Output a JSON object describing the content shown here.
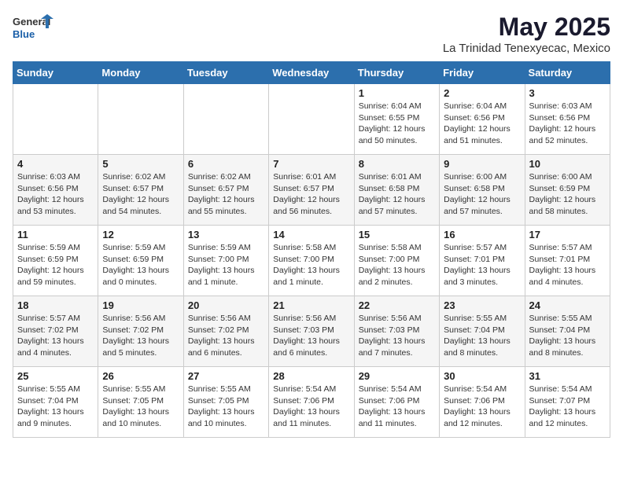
{
  "header": {
    "logo_general": "General",
    "logo_blue": "Blue",
    "month_year": "May 2025",
    "location": "La Trinidad Tenexyecac, Mexico"
  },
  "weekdays": [
    "Sunday",
    "Monday",
    "Tuesday",
    "Wednesday",
    "Thursday",
    "Friday",
    "Saturday"
  ],
  "weeks": [
    [
      {
        "day": "",
        "info": ""
      },
      {
        "day": "",
        "info": ""
      },
      {
        "day": "",
        "info": ""
      },
      {
        "day": "",
        "info": ""
      },
      {
        "day": "1",
        "info": "Sunrise: 6:04 AM\nSunset: 6:55 PM\nDaylight: 12 hours\nand 50 minutes."
      },
      {
        "day": "2",
        "info": "Sunrise: 6:04 AM\nSunset: 6:56 PM\nDaylight: 12 hours\nand 51 minutes."
      },
      {
        "day": "3",
        "info": "Sunrise: 6:03 AM\nSunset: 6:56 PM\nDaylight: 12 hours\nand 52 minutes."
      }
    ],
    [
      {
        "day": "4",
        "info": "Sunrise: 6:03 AM\nSunset: 6:56 PM\nDaylight: 12 hours\nand 53 minutes."
      },
      {
        "day": "5",
        "info": "Sunrise: 6:02 AM\nSunset: 6:57 PM\nDaylight: 12 hours\nand 54 minutes."
      },
      {
        "day": "6",
        "info": "Sunrise: 6:02 AM\nSunset: 6:57 PM\nDaylight: 12 hours\nand 55 minutes."
      },
      {
        "day": "7",
        "info": "Sunrise: 6:01 AM\nSunset: 6:57 PM\nDaylight: 12 hours\nand 56 minutes."
      },
      {
        "day": "8",
        "info": "Sunrise: 6:01 AM\nSunset: 6:58 PM\nDaylight: 12 hours\nand 57 minutes."
      },
      {
        "day": "9",
        "info": "Sunrise: 6:00 AM\nSunset: 6:58 PM\nDaylight: 12 hours\nand 57 minutes."
      },
      {
        "day": "10",
        "info": "Sunrise: 6:00 AM\nSunset: 6:59 PM\nDaylight: 12 hours\nand 58 minutes."
      }
    ],
    [
      {
        "day": "11",
        "info": "Sunrise: 5:59 AM\nSunset: 6:59 PM\nDaylight: 12 hours\nand 59 minutes."
      },
      {
        "day": "12",
        "info": "Sunrise: 5:59 AM\nSunset: 6:59 PM\nDaylight: 13 hours\nand 0 minutes."
      },
      {
        "day": "13",
        "info": "Sunrise: 5:59 AM\nSunset: 7:00 PM\nDaylight: 13 hours\nand 1 minute."
      },
      {
        "day": "14",
        "info": "Sunrise: 5:58 AM\nSunset: 7:00 PM\nDaylight: 13 hours\nand 1 minute."
      },
      {
        "day": "15",
        "info": "Sunrise: 5:58 AM\nSunset: 7:00 PM\nDaylight: 13 hours\nand 2 minutes."
      },
      {
        "day": "16",
        "info": "Sunrise: 5:57 AM\nSunset: 7:01 PM\nDaylight: 13 hours\nand 3 minutes."
      },
      {
        "day": "17",
        "info": "Sunrise: 5:57 AM\nSunset: 7:01 PM\nDaylight: 13 hours\nand 4 minutes."
      }
    ],
    [
      {
        "day": "18",
        "info": "Sunrise: 5:57 AM\nSunset: 7:02 PM\nDaylight: 13 hours\nand 4 minutes."
      },
      {
        "day": "19",
        "info": "Sunrise: 5:56 AM\nSunset: 7:02 PM\nDaylight: 13 hours\nand 5 minutes."
      },
      {
        "day": "20",
        "info": "Sunrise: 5:56 AM\nSunset: 7:02 PM\nDaylight: 13 hours\nand 6 minutes."
      },
      {
        "day": "21",
        "info": "Sunrise: 5:56 AM\nSunset: 7:03 PM\nDaylight: 13 hours\nand 6 minutes."
      },
      {
        "day": "22",
        "info": "Sunrise: 5:56 AM\nSunset: 7:03 PM\nDaylight: 13 hours\nand 7 minutes."
      },
      {
        "day": "23",
        "info": "Sunrise: 5:55 AM\nSunset: 7:04 PM\nDaylight: 13 hours\nand 8 minutes."
      },
      {
        "day": "24",
        "info": "Sunrise: 5:55 AM\nSunset: 7:04 PM\nDaylight: 13 hours\nand 8 minutes."
      }
    ],
    [
      {
        "day": "25",
        "info": "Sunrise: 5:55 AM\nSunset: 7:04 PM\nDaylight: 13 hours\nand 9 minutes."
      },
      {
        "day": "26",
        "info": "Sunrise: 5:55 AM\nSunset: 7:05 PM\nDaylight: 13 hours\nand 10 minutes."
      },
      {
        "day": "27",
        "info": "Sunrise: 5:55 AM\nSunset: 7:05 PM\nDaylight: 13 hours\nand 10 minutes."
      },
      {
        "day": "28",
        "info": "Sunrise: 5:54 AM\nSunset: 7:06 PM\nDaylight: 13 hours\nand 11 minutes."
      },
      {
        "day": "29",
        "info": "Sunrise: 5:54 AM\nSunset: 7:06 PM\nDaylight: 13 hours\nand 11 minutes."
      },
      {
        "day": "30",
        "info": "Sunrise: 5:54 AM\nSunset: 7:06 PM\nDaylight: 13 hours\nand 12 minutes."
      },
      {
        "day": "31",
        "info": "Sunrise: 5:54 AM\nSunset: 7:07 PM\nDaylight: 13 hours\nand 12 minutes."
      }
    ]
  ]
}
